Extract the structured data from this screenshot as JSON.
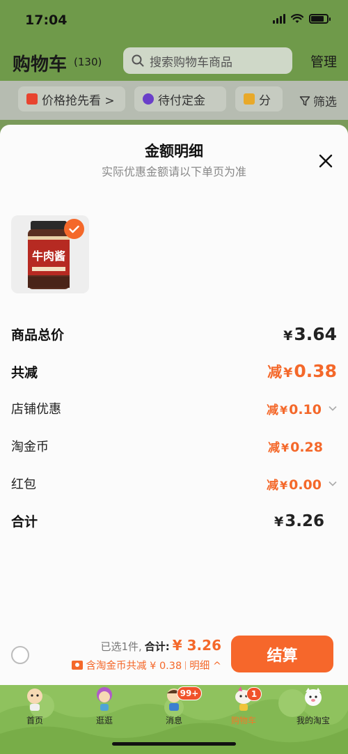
{
  "status_bar": {
    "time": "17:04"
  },
  "header": {
    "title": "购物车",
    "count": "(130)",
    "search_placeholder": "搜索购物车商品",
    "manage": "管理"
  },
  "filters": {
    "chips": [
      {
        "label": "价格抢先看 >",
        "icon": "price-tag-icon",
        "color": "#e8442f"
      },
      {
        "label": "待付定金",
        "icon": "clock-icon",
        "color": "#6a3fc9"
      },
      {
        "label": "分",
        "icon": "folder-icon",
        "color": "#e8a92a"
      }
    ],
    "filter_label": "筛选"
  },
  "sheet": {
    "title": "金额明细",
    "subtitle": "实际优惠金额请以下单页为准",
    "product": {
      "jar_text": "牛肉酱"
    },
    "rows": {
      "goods_total": {
        "label": "商品总价",
        "currency": "¥",
        "amount": "3.64"
      },
      "total_reduction": {
        "label": "共减",
        "prefix": "减",
        "currency": "¥",
        "amount": "0.38"
      },
      "store_discount": {
        "label": "店铺优惠",
        "prefix": "减",
        "currency": "¥",
        "amount": "0.10"
      },
      "taojinbi": {
        "label": "淘金币",
        "prefix": "减",
        "currency": "¥",
        "amount": "0.28"
      },
      "red_packet": {
        "label": "红包",
        "prefix": "减",
        "currency": "¥",
        "amount": "0.00"
      },
      "grand_total": {
        "label": "合计",
        "currency": "¥",
        "amount": "3.26"
      }
    }
  },
  "checkout": {
    "selected": "已选1件,",
    "total_label": "合计:",
    "total_value": "¥ 3.26",
    "discount_text": "含淘金币共减 ¥ 0.38",
    "detail_link": "明细 ^",
    "button": "结算"
  },
  "tabs": [
    {
      "label": "首页"
    },
    {
      "label": "逛逛"
    },
    {
      "label": "消息",
      "badge": "99+"
    },
    {
      "label": "购物车",
      "badge": "1",
      "active": true
    },
    {
      "label": "我的淘宝"
    }
  ],
  "colors": {
    "accent": "#f4682a",
    "header_green": "#6f9a4a",
    "tab_green": "#8fc25e"
  }
}
